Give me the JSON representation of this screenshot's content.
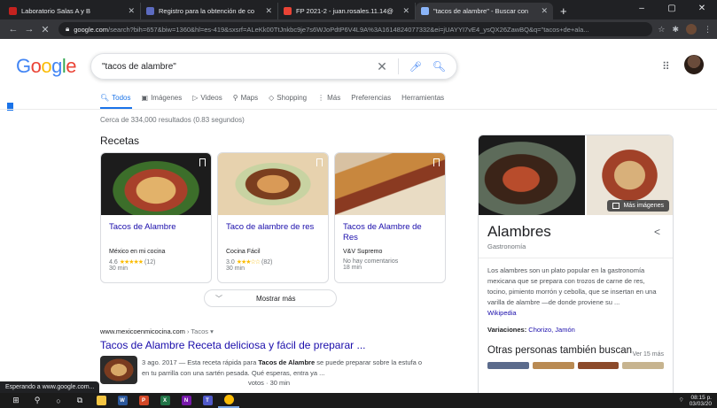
{
  "browser": {
    "tabs": [
      {
        "label": "Laboratorio Salas A y B",
        "icon": "classroom-icon",
        "color": "#c5221f",
        "active": false
      },
      {
        "label": "Registro para la obtención de co",
        "icon": "form-icon",
        "color": "#5c6bc0",
        "active": false
      },
      {
        "label": "FP 2021-2 - juan.rosales.11.14@",
        "icon": "gmail-icon",
        "color": "#ea4335",
        "active": false
      },
      {
        "label": "\"tacos de alambre\" - Buscar con",
        "icon": "google-icon",
        "color": "#8ab4f8",
        "active": true
      }
    ],
    "new_tab": "+",
    "window_controls": {
      "minimize": "–",
      "maximize": "▢",
      "close": "✕"
    },
    "nav": {
      "back": "←",
      "forward": "→",
      "reload": "✕"
    },
    "url_host": "google.com",
    "url_rest": "/search?bih=657&biw=1360&hl=es-419&sxsrf=ALeKk00TtJnkbc9je7s6WJoPdtP6V4L9A%3A1614824077332&ei=jUAYYI7vE4_ysQX26ZawBQ&q=\"tacos+de+ala..."
  },
  "google": {
    "logo_letters": [
      "G",
      "o",
      "o",
      "g",
      "l",
      "e"
    ],
    "query": "\"tacos de alambre\"",
    "clear": "✕",
    "tabs": [
      {
        "label": "Todos",
        "icon": "search-icon",
        "glyph": "🔍︎",
        "active": true
      },
      {
        "label": "Imágenes",
        "icon": "image-icon",
        "glyph": "▣",
        "active": false
      },
      {
        "label": "Videos",
        "icon": "video-icon",
        "glyph": "▷",
        "active": false
      },
      {
        "label": "Maps",
        "icon": "map-pin-icon",
        "glyph": "⚲",
        "active": false
      },
      {
        "label": "Shopping",
        "icon": "tag-icon",
        "glyph": "◇",
        "active": false
      },
      {
        "label": "Más",
        "icon": "more-icon",
        "glyph": "⋮",
        "active": false
      }
    ],
    "tools": [
      "Preferencias",
      "Herramientas"
    ],
    "result_stats": "Cerca de 334,000 resultados (0.83 segundos)"
  },
  "recipes": {
    "title": "Recetas",
    "items": [
      {
        "title": "Tacos de Alambre",
        "source": "México en mi cocina",
        "rating": "4.6",
        "stars": "★★★★★",
        "reviews": "(12)",
        "time": "30 min"
      },
      {
        "title": "Taco de alambre de res",
        "source": "Cocina Fácil",
        "rating": "3.0",
        "stars": "★★★☆☆",
        "reviews": "(82)",
        "time": "30 min"
      },
      {
        "title": "Tacos de Alambre de Res",
        "source": "V&V Supremo",
        "rating": "",
        "stars": "",
        "reviews": "No hay comentarios",
        "time": "18 min"
      }
    ],
    "show_more": "Mostrar más"
  },
  "result": {
    "breadcrumb": "www.mexicoenmicocina.com",
    "breadcrumb_path": " › Tacos ▾",
    "title": "Tacos de Alambre Receta deliciosa y fácil de preparar ...",
    "date": "3 ago. 2017",
    "snippet_pre": " — Esta receta rápida para ",
    "snippet_bold": "Tacos de Alambre",
    "snippet_post": " se puede preparar sobre la estufa o en tu parrilla con una sartén pesada. Qué esperas, entra ya ...",
    "meta": "votos · 30 min"
  },
  "knowledge_panel": {
    "more_images": "Más imágenes",
    "title": "Alambres",
    "subtitle": "Gastronomía",
    "description": "Los alambres son un plato popular en la gastronomía mexicana que se prepara con trozos de carne de res, tocino, pimiento morrón y cebolla, que se insertan en una varilla de alambre —de donde proviene su ...",
    "wiki": "Wikipedia",
    "variations_label": "Variaciones:",
    "variations": "Chorizo, Jamón",
    "others_title": "Otras personas también buscan",
    "others_more": "Ver 15 más"
  },
  "status": "Esperando a www.google.com...",
  "taskbar": {
    "items": [
      {
        "icon": "windows-start-icon",
        "glyph": "⊞",
        "color": "",
        "active": false
      },
      {
        "icon": "search-icon",
        "glyph": "⚲",
        "color": "",
        "active": false
      },
      {
        "icon": "cortana-icon",
        "glyph": "○",
        "color": "",
        "active": false
      },
      {
        "icon": "task-view-icon",
        "glyph": "⧉",
        "color": "",
        "active": false
      },
      {
        "icon": "file-explorer-icon",
        "glyph": "",
        "color": "#f4c542",
        "active": false
      },
      {
        "icon": "word-icon",
        "glyph": "W",
        "color": "#2b579a",
        "active": false
      },
      {
        "icon": "powerpoint-icon",
        "glyph": "P",
        "color": "#d24726",
        "active": false
      },
      {
        "icon": "excel-icon",
        "glyph": "X",
        "color": "#217346",
        "active": false
      },
      {
        "icon": "onenote-icon",
        "glyph": "N",
        "color": "#7719aa",
        "active": false
      },
      {
        "icon": "teams-icon",
        "glyph": "T",
        "color": "#5059c9",
        "active": false
      },
      {
        "icon": "chrome-icon",
        "glyph": "",
        "color": "#fbbc05",
        "active": true
      }
    ],
    "time": "08:15 p.",
    "date": "03/03/20"
  }
}
